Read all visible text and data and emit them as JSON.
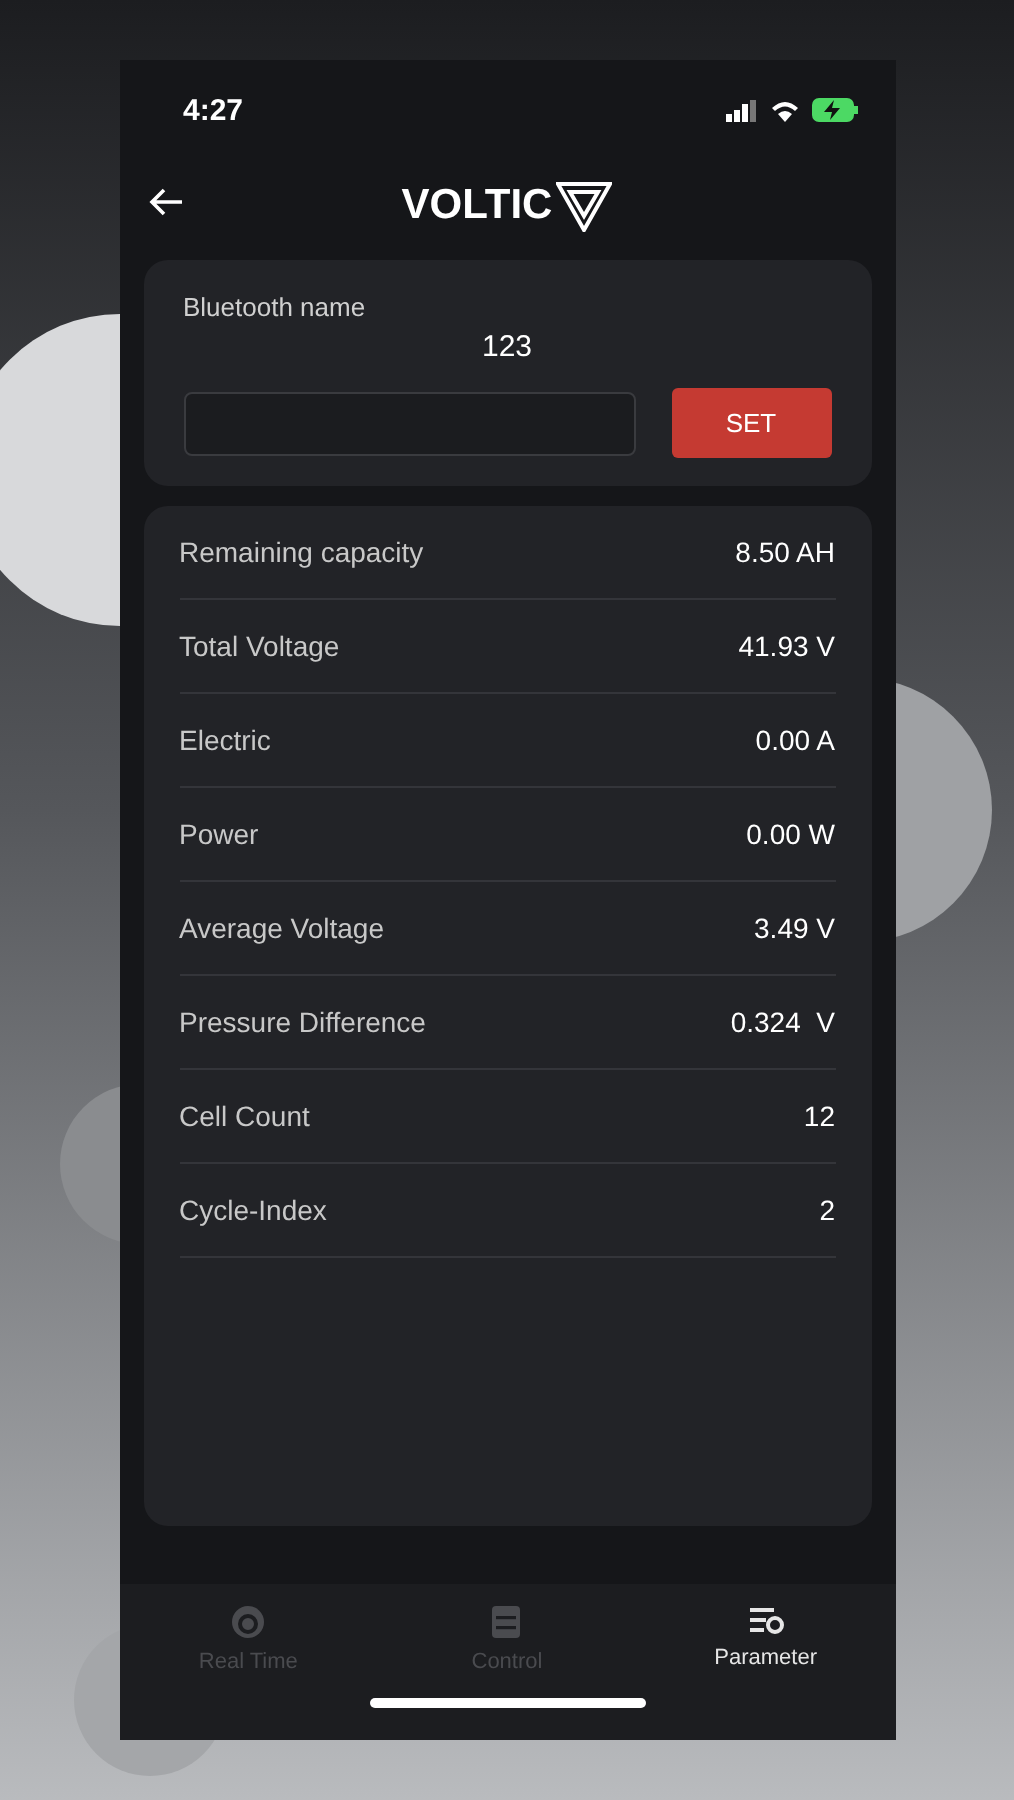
{
  "status_bar": {
    "time": "4:27"
  },
  "header": {
    "logo": "VOLTIC"
  },
  "bluetooth": {
    "label": "Bluetooth name",
    "current": "123",
    "button": "SET"
  },
  "parameters": [
    {
      "name": "Remaining capacity",
      "value": "8.50 AH"
    },
    {
      "name": "Total Voltage",
      "value": "41.93 V"
    },
    {
      "name": "Electric",
      "value": "0.00 A"
    },
    {
      "name": "Power",
      "value": "0.00 W"
    },
    {
      "name": "Average Voltage",
      "value": "3.49 V"
    },
    {
      "name": "Pressure Difference",
      "value": "0.324  V"
    },
    {
      "name": "Cell Count",
      "value": "12"
    },
    {
      "name": "Cycle-Index",
      "value": "2"
    }
  ],
  "tabs": [
    {
      "label": "Real Time",
      "kind": "gauge",
      "selected": false
    },
    {
      "label": "Control",
      "kind": "sliders",
      "selected": false
    },
    {
      "label": "Parameter",
      "kind": "list",
      "selected": true
    }
  ]
}
